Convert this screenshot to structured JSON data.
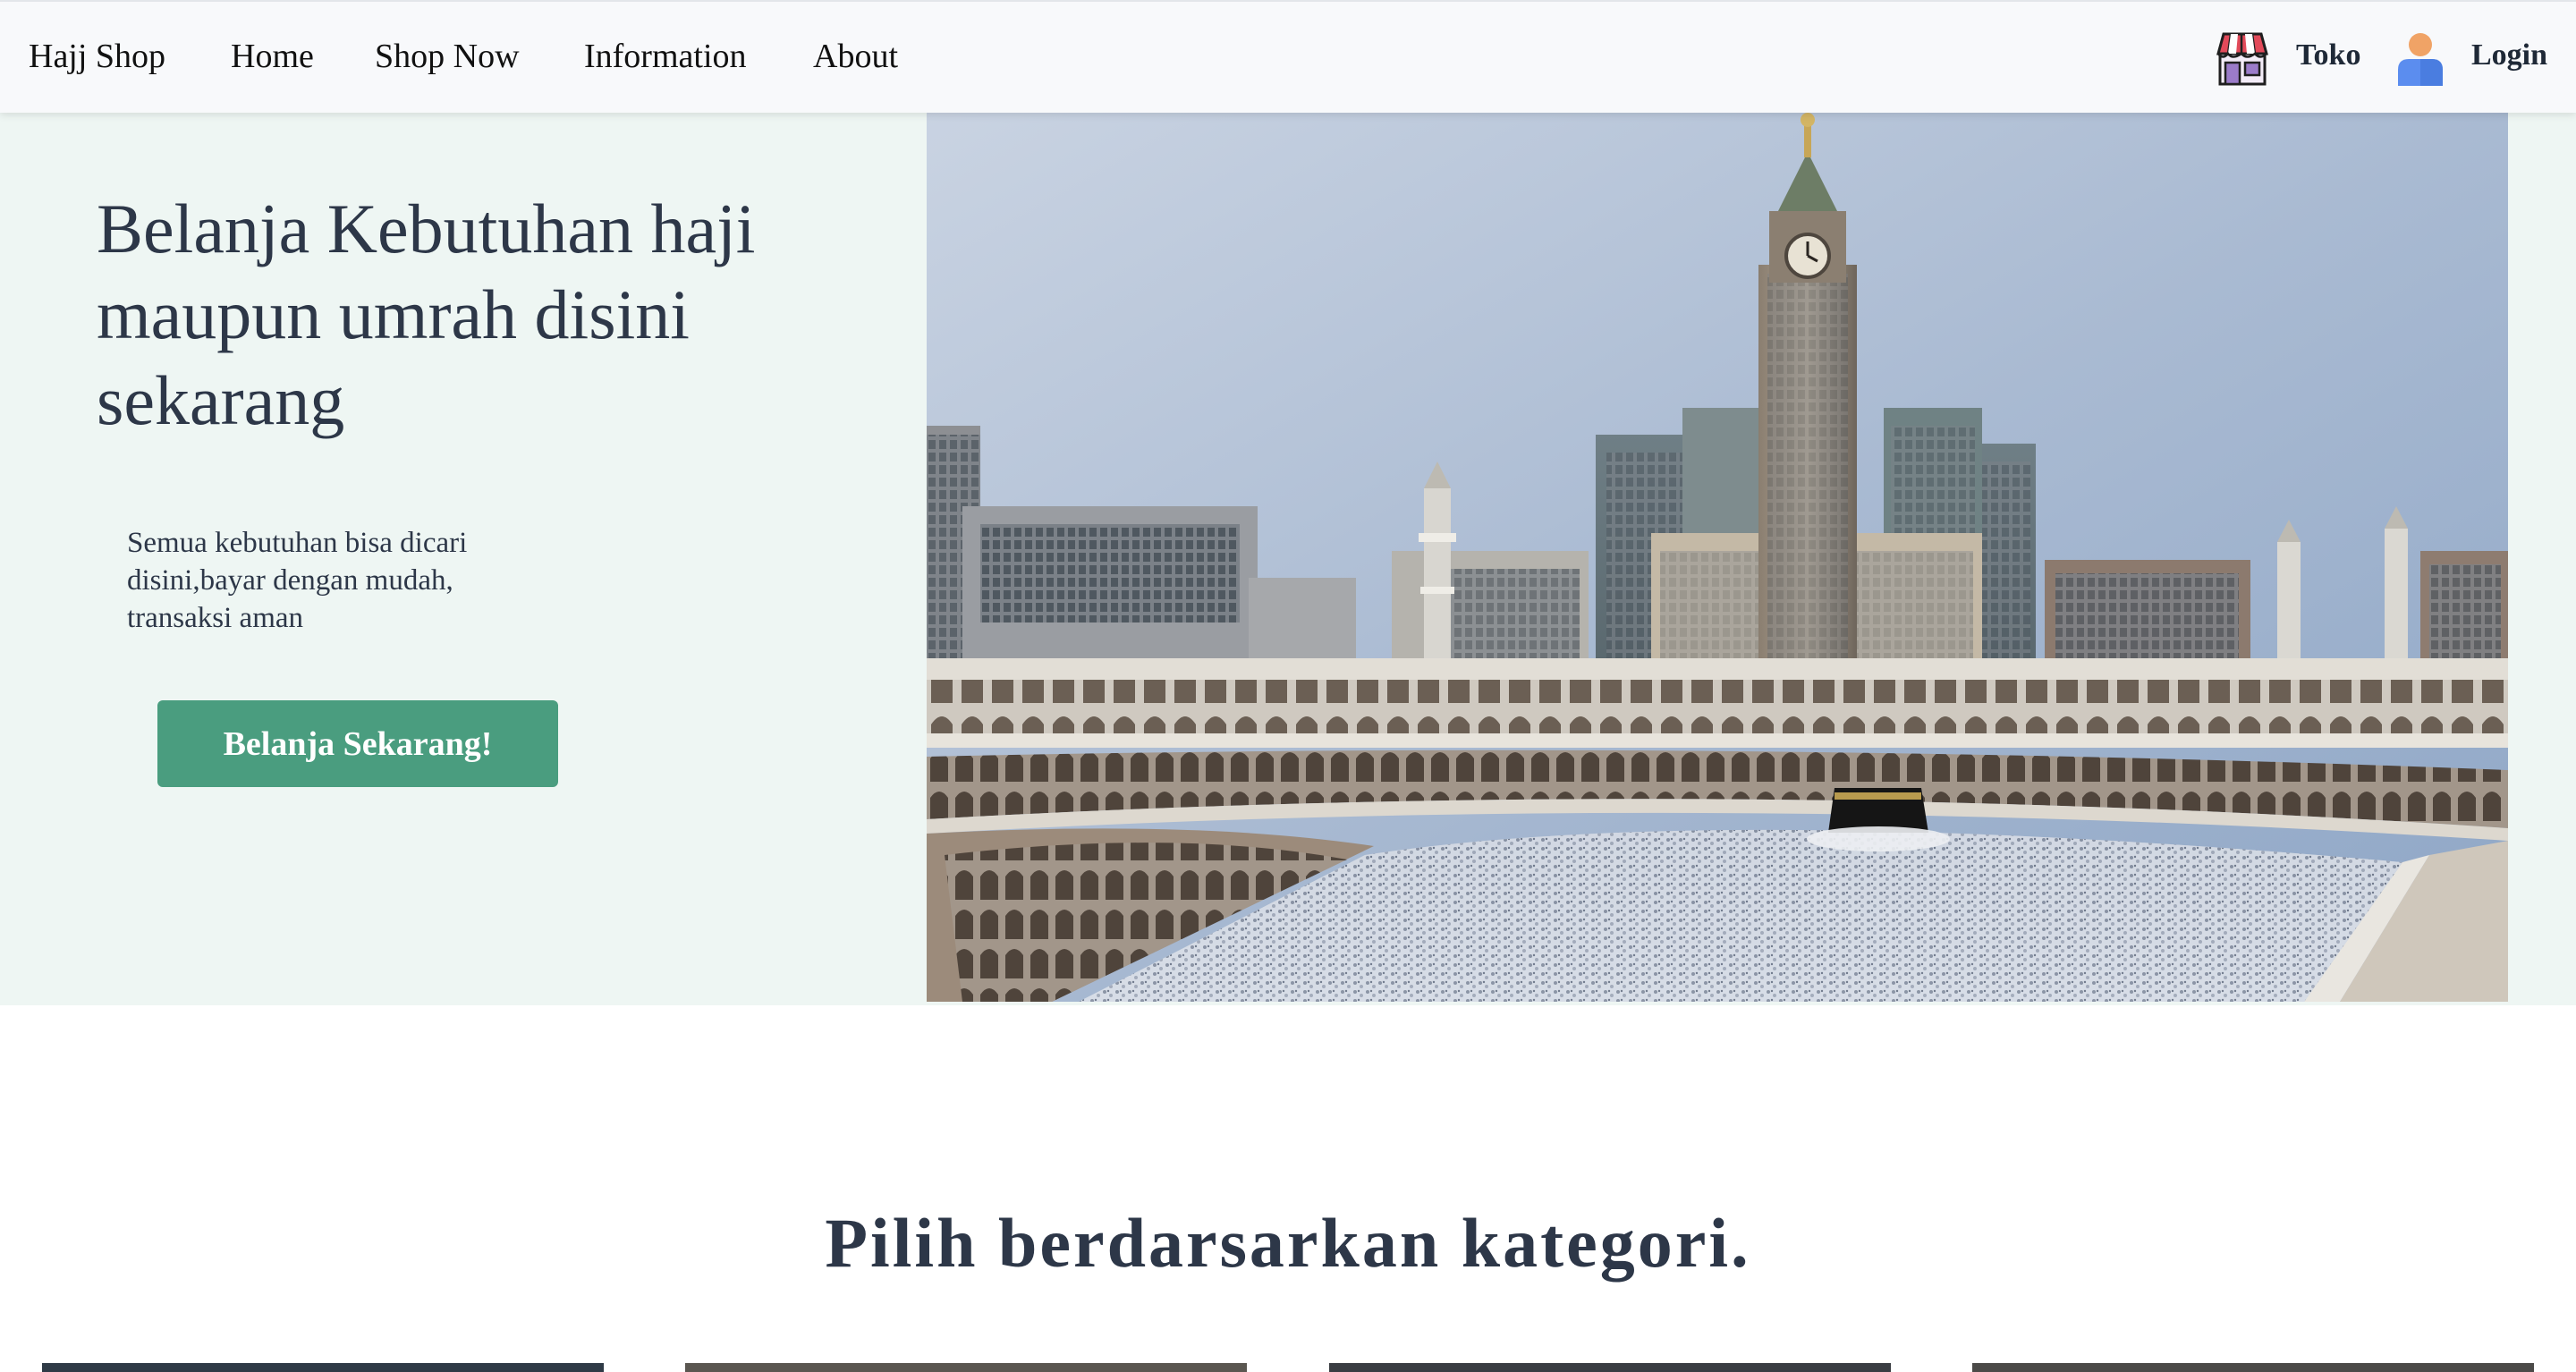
{
  "navbar": {
    "brand": "Hajj Shop",
    "links": [
      "Home",
      "Shop Now",
      "Information",
      "About"
    ],
    "store_label": "Toko",
    "login_label": "Login",
    "store_icon": "storefront-icon",
    "user_icon": "user-icon"
  },
  "hero": {
    "title": "Belanja Kebutuhan haji maupun umrah disini sekarang",
    "description": "Semua kebutuhan bisa dicari disini,bayar dengan mudah, transaksi aman",
    "cta_label": "Belanja Sekarang!",
    "image_subject": "masjid-al-haram-kaaba-photo"
  },
  "categories": {
    "heading": "Pilih berdarsarkan kategori."
  },
  "colors": {
    "navbar_bg": "#f8f9fb",
    "hero_bg": "#eef6f3",
    "accent": "#4a9d7f",
    "text_dark": "#2d3748"
  }
}
